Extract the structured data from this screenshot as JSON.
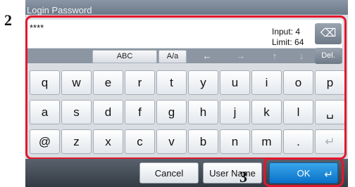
{
  "screen": {
    "title": "Login Password",
    "input_value": "****",
    "input_counter_label": "Input:",
    "input_counter_value": "4",
    "limit_label": "Limit:",
    "limit_value": "64"
  },
  "toolbar": {
    "keyboard_type_label": "ABC",
    "case_toggle_label": "A/a",
    "delete_label": "Del.",
    "arrows": [
      "←",
      "→",
      "↑",
      "↓"
    ]
  },
  "keyboard": {
    "row1": [
      "q",
      "w",
      "e",
      "r",
      "t",
      "y",
      "u",
      "i",
      "o",
      "p"
    ],
    "row2": [
      "a",
      "s",
      "d",
      "f",
      "g",
      "h",
      "j",
      "k",
      "l",
      "␣"
    ],
    "row3": [
      "@",
      "z",
      "x",
      "c",
      "v",
      "b",
      "n",
      "m",
      ".",
      "↵"
    ]
  },
  "bottom_bar": {
    "cancel_label": "Cancel",
    "username_label": "User Name",
    "ok_label": "OK"
  },
  "callouts": {
    "step_2": "2",
    "step_3": "3"
  },
  "colors": {
    "highlight_frame": "#e3172c",
    "ok_button": "#0a72c9",
    "panel_bg": "#d9dde2"
  },
  "icons": {
    "backspace": "backspace-icon",
    "enter": "enter-icon"
  }
}
